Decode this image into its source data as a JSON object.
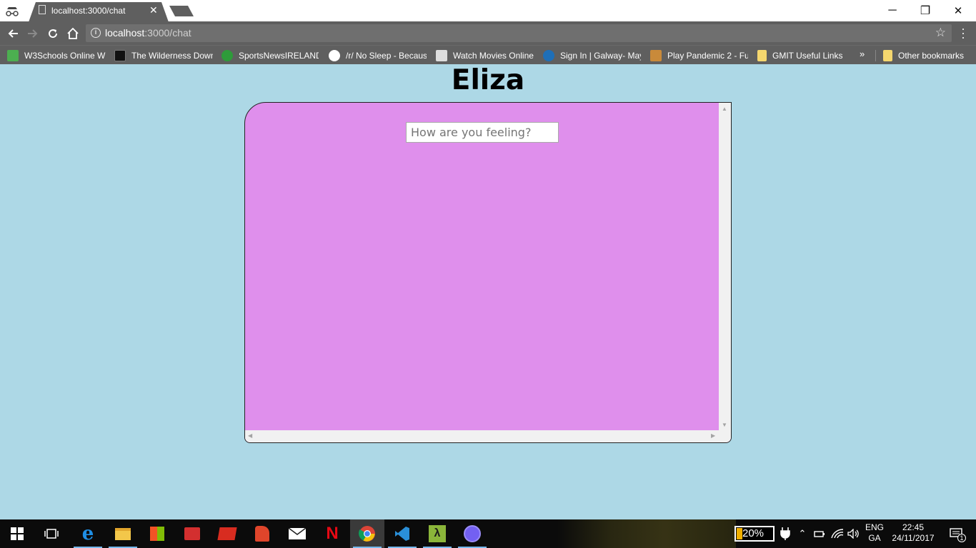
{
  "browser": {
    "tab": {
      "title": "localhost:3000/chat",
      "close": "✕"
    },
    "address": {
      "host": "localhost",
      "path": ":3000/chat"
    },
    "window_controls": {
      "minimize": "─",
      "restore": "❐",
      "close": "✕"
    },
    "nav": {
      "back": "←",
      "forward": "→",
      "reload": "⟳",
      "home": "⌂"
    },
    "star": "☆",
    "bookmarks": [
      {
        "label": "W3Schools Online W",
        "icon": "w3schools-icon",
        "color": "#4caf50"
      },
      {
        "label": "The Wilderness Down",
        "icon": "wilderness-icon",
        "color": "#111111"
      },
      {
        "label": "SportsNewsIRELAND",
        "icon": "sportsnews-icon",
        "color": "#2e9b3a"
      },
      {
        "label": "/r/ No Sleep - Becaus",
        "icon": "reddit-icon",
        "color": "#ffffff"
      },
      {
        "label": "Watch Movies Online",
        "icon": "tv-icon",
        "color": "#dddddd"
      },
      {
        "label": "Sign In | Galway- May",
        "icon": "gmit-icon",
        "color": "#1e6fb8"
      },
      {
        "label": "Play Pandemic 2 - Fu",
        "icon": "pandemic-icon",
        "color": "#c98a3a"
      },
      {
        "label": "GMIT Useful Links",
        "icon": "folder-icon",
        "color": "#f5d76e"
      }
    ],
    "more": "»",
    "other_bookmarks": "Other bookmarks"
  },
  "page": {
    "title": "Eliza",
    "input_placeholder": "How are you feeling?"
  },
  "taskbar": {
    "battery": "20%",
    "lang_top": "ENG",
    "lang_bottom": "GA",
    "time": "22:45",
    "date": "24/11/2017",
    "notifications": "1",
    "apps": [
      "start-icon",
      "task-view-icon",
      "edge-icon",
      "file-explorer-icon",
      "store-icon",
      "reader-icon",
      "redis-icon",
      "app-icon",
      "mail-icon",
      "netflix-icon",
      "chrome-icon",
      "vscode-icon",
      "lambda-app-icon",
      "viber-icon"
    ]
  }
}
